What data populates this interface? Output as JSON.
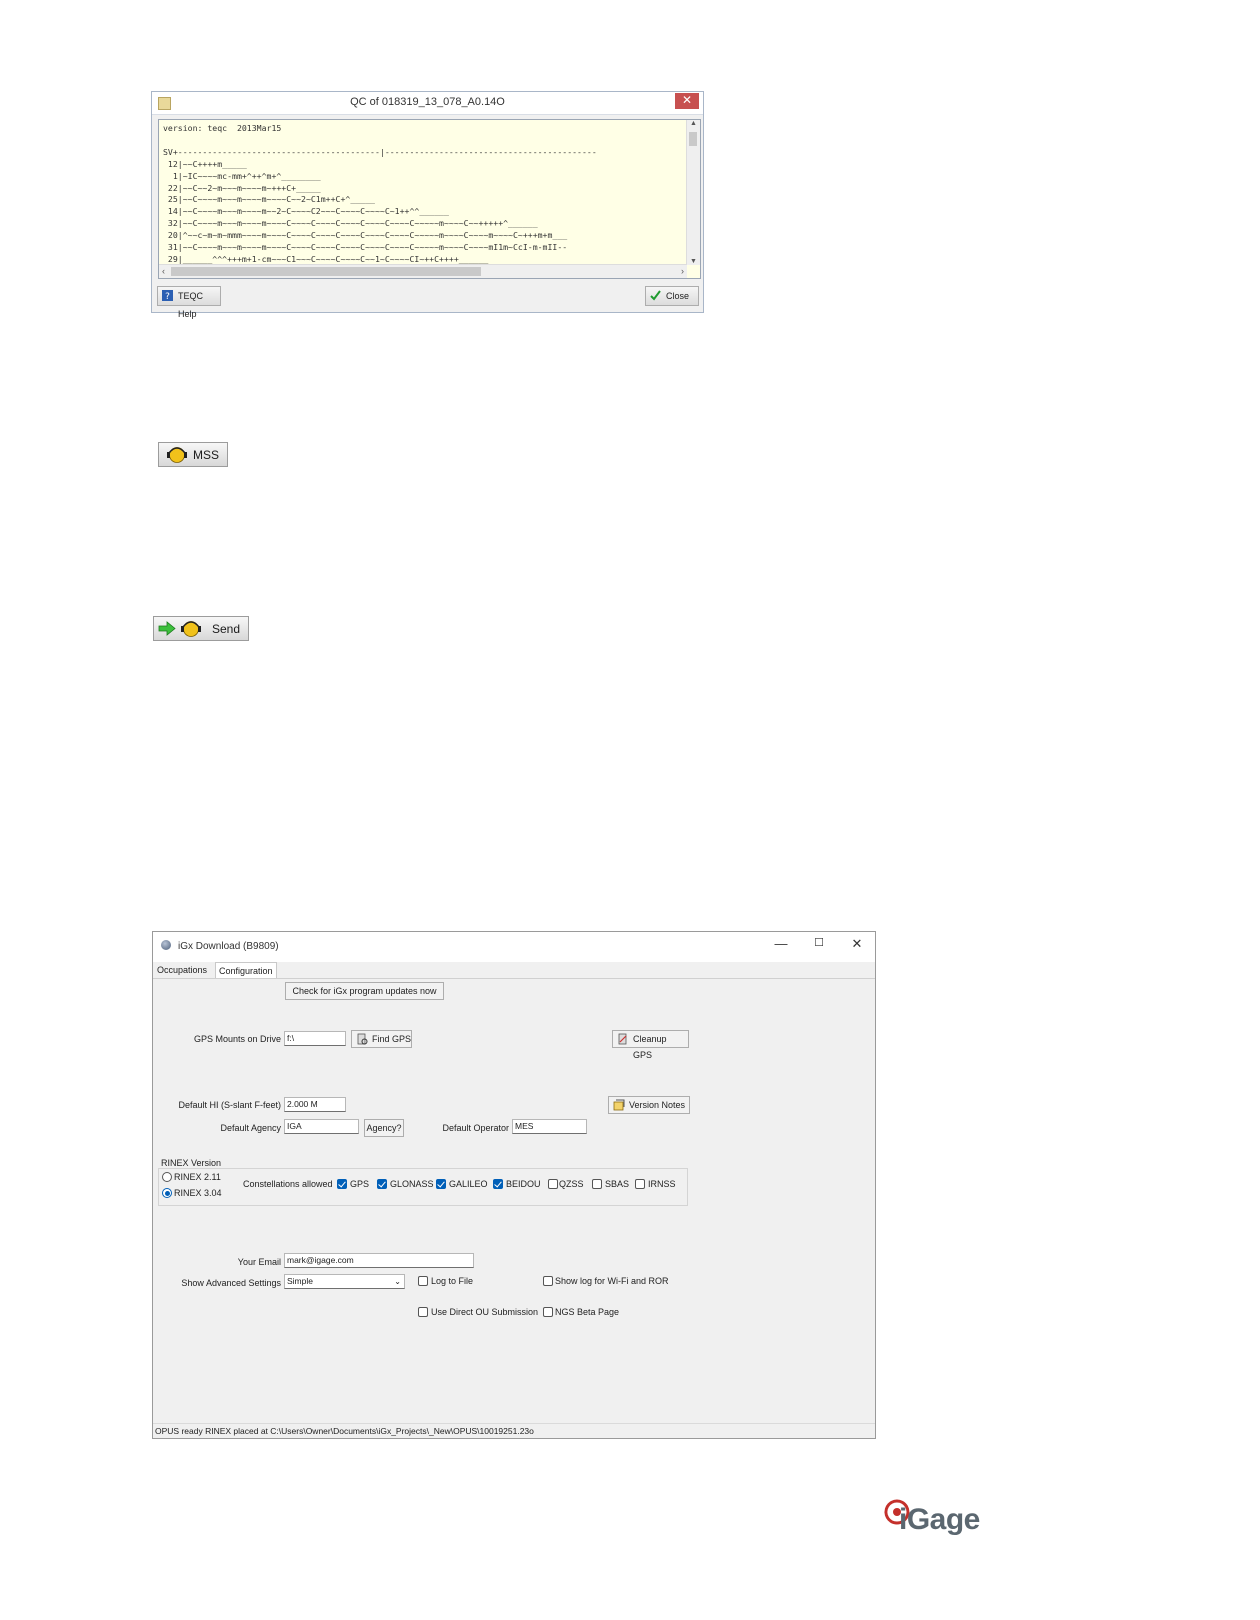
{
  "qc_dialog": {
    "title": "QC of 018319_13_078_A0.14O",
    "close_x": "✕",
    "text": "version: teqc  2013Mar15\n\nSV+-----------------------------------------|-------------------------------------------\n 12|~~C++++m_____\n  1|~IC~~~~mc-mm+^++^m+^________\n 22|~~C~~2~m~~~m~~~~m~+++C+_____\n 25|~~C~~~~m~~~m~~~~m~~~~C~~2~C1m++C+^_____\n 14|~~C~~~~m~~~m~~~~m~~2~C~~~~C2~~~C~~~~C~~~~C~1++^^______\n 32|~~C~~~~m~~~m~~~~m~~~~C~~~~C~~~~C~~~~C~~~~C~~~~C~~~~~m~~~~C~~+++++^______\n 20|^~~c~m~m~mmm~~~~m~~~~C~~~~C~~~~C~~~~C~~~~C~~~~C~~~~~m~~~~C~~~~m~~~~C~+++m+m___\n 31|~~C~~~~m~~~m~~~~m~~~~C~~~~C~~~~C~~~~C~~~~C~~~~C~~~~~m~~~~C~~~~mI1m~CcI-m-mII--\n 29|______^^^+++m+1-cm~~~C1~~~C~~~~C~~~~C~~1~C~~~~CI~++C++++______",
    "help_button": "TEQC Help",
    "close_button": "Close"
  },
  "mss_button": {
    "label": "MSS"
  },
  "send_button": {
    "label": "Send"
  },
  "igx_window": {
    "title": "iGx Download  (B9809)",
    "controls": {
      "minimize": "—",
      "maximize": "☐",
      "close": "✕"
    },
    "tabs": [
      "Occupations",
      "Configuration"
    ],
    "check_updates_button": "Check for iGx program updates now",
    "gps_mounts_label": "GPS Mounts on Drive",
    "gps_mounts_value": "f:\\",
    "find_gps_button": "Find GPS",
    "cleanup_gps_button": "Cleanup GPS",
    "default_hi_label": "Default HI (S-slant F-feet)",
    "default_hi_value": "2.000 M",
    "version_notes_button": "Version Notes",
    "default_agency_label": "Default Agency",
    "default_agency_value": "IGA",
    "agency_button": "Agency?",
    "default_operator_label": "Default Operator",
    "default_operator_value": "MES",
    "rinex_group_label": "RINEX Version",
    "rinex_211": "RINEX 2.11",
    "rinex_304": "RINEX 3.04",
    "constellations_label": "Constellations allowed",
    "constellations": [
      {
        "name": "GPS",
        "checked": true
      },
      {
        "name": "GLONASS",
        "checked": true
      },
      {
        "name": "GALILEO",
        "checked": true
      },
      {
        "name": "BEIDOU",
        "checked": true
      },
      {
        "name": "QZSS",
        "checked": false
      },
      {
        "name": "SBAS",
        "checked": false
      },
      {
        "name": "IRNSS",
        "checked": false
      }
    ],
    "email_label": "Your Email",
    "email_value": "mark@igage.com",
    "advanced_label": "Show Advanced Settings",
    "advanced_value": "Simple",
    "log_to_file": "Log to File",
    "show_log_wifi": "Show log for Wi-Fi and ROR",
    "use_direct_ou": "Use Direct OU Submission",
    "ngs_beta": "NGS Beta Page",
    "status_text": "OPUS ready RINEX placed at C:\\Users\\Owner\\Documents\\iGx_Projects\\_New\\OPUS\\10019251.23o"
  },
  "brand": {
    "logo_text": "iGage",
    "accent": "#c4302b",
    "text_color": "#5b6770"
  }
}
